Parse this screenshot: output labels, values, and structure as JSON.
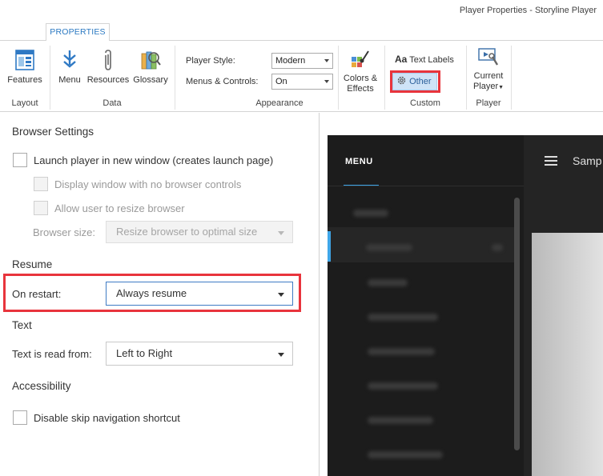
{
  "window": {
    "title": "Player Properties - Storyline Player"
  },
  "ribbon": {
    "tab_label": "PROPERTIES",
    "groups": {
      "layout": {
        "label": "Layout",
        "features": "Features"
      },
      "data": {
        "label": "Data",
        "menu": "Menu",
        "resources": "Resources",
        "glossary": "Glossary"
      },
      "appearance": {
        "label": "Appearance",
        "player_style_label": "Player Style:",
        "player_style_value": "Modern",
        "menus_controls_label": "Menus & Controls:",
        "menus_controls_value": "On",
        "colors_effects_line1": "Colors &",
        "colors_effects_line2": "Effects"
      },
      "custom": {
        "label": "Custom",
        "text_labels": "Text Labels",
        "text_labels_prefix": "Aa",
        "other": "Other"
      },
      "player": {
        "label": "Player",
        "current_player_line1": "Current",
        "current_player_line2": "Player"
      }
    }
  },
  "settings": {
    "browser": {
      "heading": "Browser Settings",
      "launch_new_window": "Launch player in new window (creates launch page)",
      "display_no_controls": "Display window with no browser controls",
      "allow_resize": "Allow user to resize browser",
      "browser_size_label": "Browser size:",
      "browser_size_value": "Resize browser to optimal size"
    },
    "resume": {
      "heading": "Resume",
      "on_restart_label": "On restart:",
      "on_restart_value": "Always resume"
    },
    "text": {
      "heading": "Text",
      "read_from_label": "Text is read from:",
      "read_from_value": "Left to Right"
    },
    "accessibility": {
      "heading": "Accessibility",
      "disable_skip_nav": "Disable skip navigation shortcut"
    }
  },
  "preview": {
    "menu_title": "MENU",
    "header_text": "Samp"
  },
  "colors": {
    "accent": "#2b79c2",
    "highlight": "#e8343c",
    "preview_accent": "#3fa6e8"
  }
}
